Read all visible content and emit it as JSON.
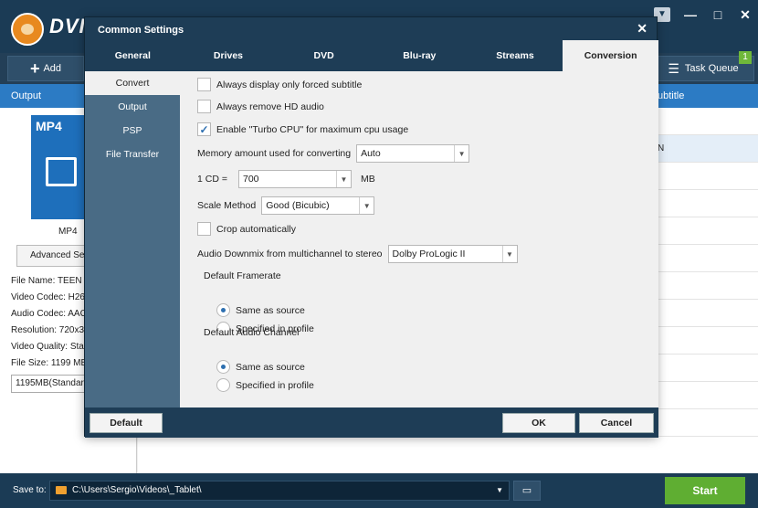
{
  "app": {
    "name": "DVI",
    "toolbar": {
      "add_label": "Add",
      "task_queue_label": "Task Queue",
      "task_badge": "1"
    },
    "header": {
      "output_col": "Output",
      "subtitle_col": "ubtitle"
    },
    "row_fragment": "N",
    "profile": {
      "tile_label": "MP4",
      "caption": "MP4",
      "advanced_button": "Advanced Se",
      "info": [
        "File Name: TEEN",
        "Video Codec: H26",
        "Audio Codec: AAC",
        "Resolution: 720x3",
        "Video Quality: Sta",
        "File Size: 1199 MB"
      ],
      "size_select": "1195MB(Standar"
    },
    "bottom": {
      "save_label": "Save to:",
      "save_path": "C:\\Users\\Sergio\\Videos\\_Tablet\\",
      "start_label": "Start"
    },
    "window_controls": {
      "dropdown": "▼",
      "minimize": "—",
      "maximize": "□",
      "close": "✕"
    }
  },
  "dialog": {
    "title": "Common Settings",
    "close": "✕",
    "tabs": [
      "General",
      "Drives",
      "DVD",
      "Blu-ray",
      "Streams",
      "Conversion"
    ],
    "active_tab": "Conversion",
    "sidebar": [
      "Convert",
      "Output",
      "PSP",
      "File Transfer"
    ],
    "active_sidebar": "Convert",
    "options": {
      "forced_subtitle": {
        "label": "Always display only forced subtitle",
        "checked": false
      },
      "remove_hd_audio": {
        "label": "Always remove HD audio",
        "checked": false
      },
      "turbo_cpu": {
        "label": "Enable \"Turbo CPU\" for maximum cpu usage",
        "checked": true
      },
      "memory": {
        "label": "Memory amount used for converting",
        "value": "Auto"
      },
      "cd_size": {
        "label": "1 CD =",
        "value": "700",
        "unit": "MB"
      },
      "scale_method": {
        "label": "Scale Method",
        "value": "Good (Bicubic)"
      },
      "crop_auto": {
        "label": "Crop automatically",
        "checked": false
      },
      "audio_downmix": {
        "label": "Audio Downmix from multichannel to stereo",
        "value": "Dolby ProLogic II"
      },
      "framerate": {
        "label": "Default Framerate",
        "options": [
          "Same as source",
          "Specified in profile"
        ],
        "selected": 0
      },
      "audio_channel": {
        "label": "Default Audio Channel",
        "options": [
          "Same as source",
          "Specified in profile"
        ],
        "selected": 0
      }
    },
    "footer": {
      "default_label": "Default",
      "ok_label": "OK",
      "cancel_label": "Cancel"
    }
  }
}
